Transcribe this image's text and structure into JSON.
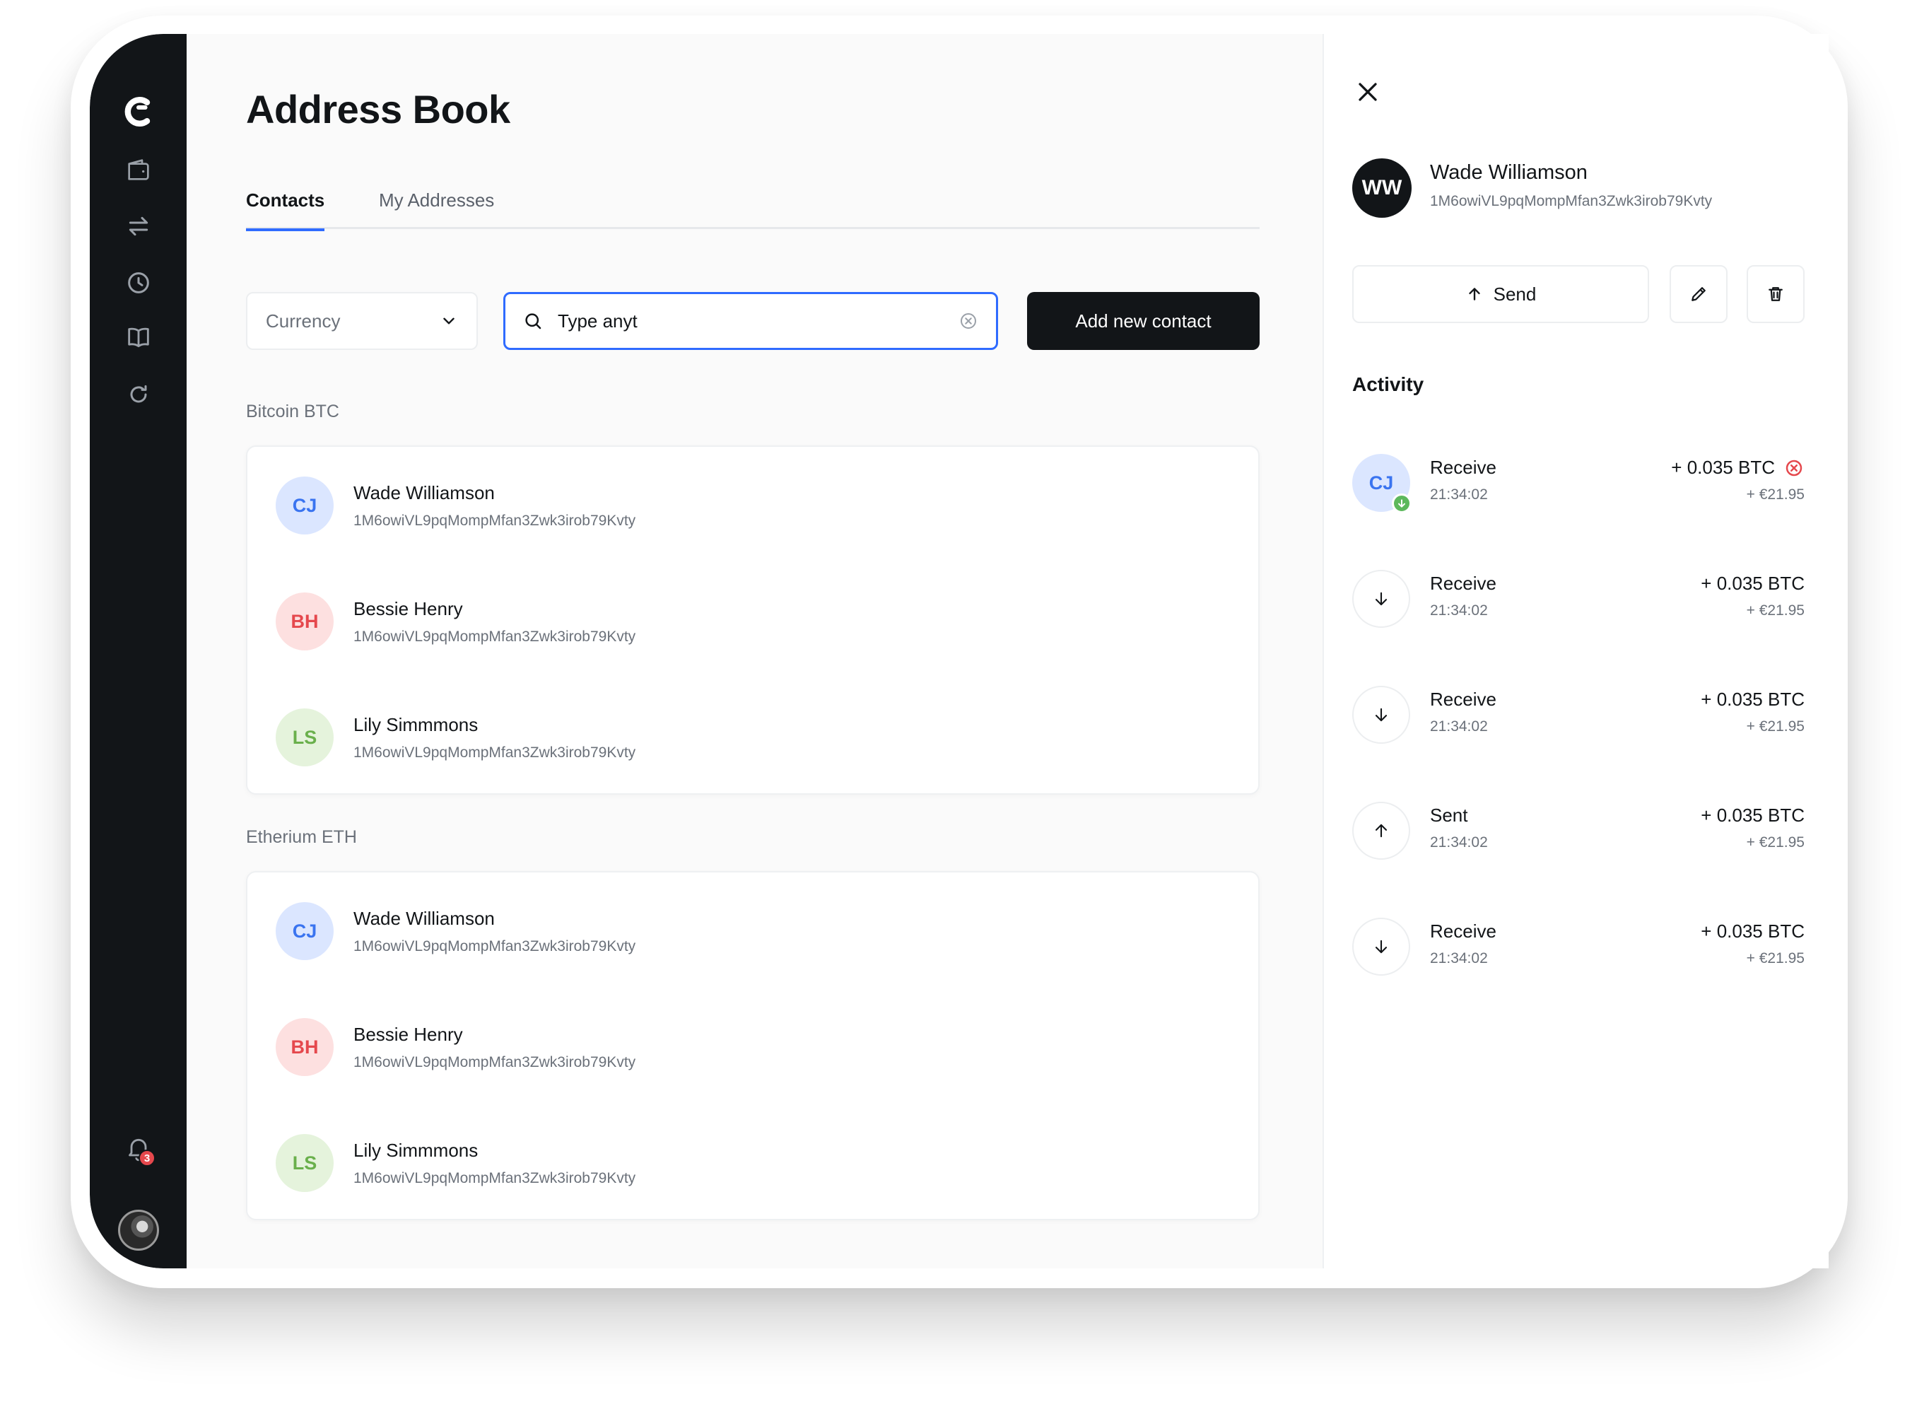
{
  "page": {
    "title": "Address Book"
  },
  "tabs": [
    {
      "label": "Contacts",
      "active": true
    },
    {
      "label": "My Addresses",
      "active": false
    }
  ],
  "filters": {
    "currency_label": "Currency",
    "search_value": "Type anyt",
    "add_button": "Add new contact"
  },
  "notifications": {
    "count": "3"
  },
  "groups": [
    {
      "label": "Bitcoin BTC",
      "contacts": [
        {
          "initials": "CJ",
          "name": "Wade Williamson",
          "address": "1M6owiVL9pqMompMfan3Zwk3irob79Kvty",
          "color": "#3a74f0"
        },
        {
          "initials": "BH",
          "name": "Bessie Henry",
          "address": "1M6owiVL9pqMompMfan3Zwk3irob79Kvty",
          "color": "#e5484d"
        },
        {
          "initials": "LS",
          "name": "Lily Simmmons",
          "address": "1M6owiVL9pqMompMfan3Zwk3irob79Kvty",
          "color": "#6ab04c"
        }
      ]
    },
    {
      "label": "Etherium ETH",
      "contacts": [
        {
          "initials": "CJ",
          "name": "Wade Williamson",
          "address": "1M6owiVL9pqMompMfan3Zwk3irob79Kvty",
          "color": "#3a74f0"
        },
        {
          "initials": "BH",
          "name": "Bessie Henry",
          "address": "1M6owiVL9pqMompMfan3Zwk3irob79Kvty",
          "color": "#e5484d"
        },
        {
          "initials": "LS",
          "name": "Lily Simmmons",
          "address": "1M6owiVL9pqMompMfan3Zwk3irob79Kvty",
          "color": "#6ab04c"
        }
      ]
    }
  ],
  "detail": {
    "initials": "WW",
    "name": "Wade Williamson",
    "address": "1M6owiVL9pqMompMfan3Zwk3irob79Kvty",
    "send_label": "Send",
    "activity_title": "Activity",
    "activity": [
      {
        "type": "Receive",
        "time": "21:34:02",
        "amount": "+ 0.035 BTC",
        "fiat": "+ €21.95",
        "icon": "CJ",
        "failed": true
      },
      {
        "type": "Receive",
        "time": "21:34:02",
        "amount": "+ 0.035 BTC",
        "fiat": "+ €21.95",
        "icon": "arrow-down-icon",
        "failed": false
      },
      {
        "type": "Receive",
        "time": "21:34:02",
        "amount": "+ 0.035 BTC",
        "fiat": "+ €21.95",
        "icon": "arrow-down-icon",
        "failed": false
      },
      {
        "type": "Sent",
        "time": "21:34:02",
        "amount": "+ 0.035 BTC",
        "fiat": "+ €21.95",
        "icon": "arrow-up-icon",
        "failed": false
      },
      {
        "type": "Receive",
        "time": "21:34:02",
        "amount": "+ 0.035 BTC",
        "fiat": "+ €21.95",
        "icon": "arrow-down-icon",
        "failed": false
      }
    ]
  },
  "colors": {
    "accent": "#2f6bff",
    "sidebar": "#121518",
    "error": "#e5484d",
    "success": "#5cb85c"
  }
}
